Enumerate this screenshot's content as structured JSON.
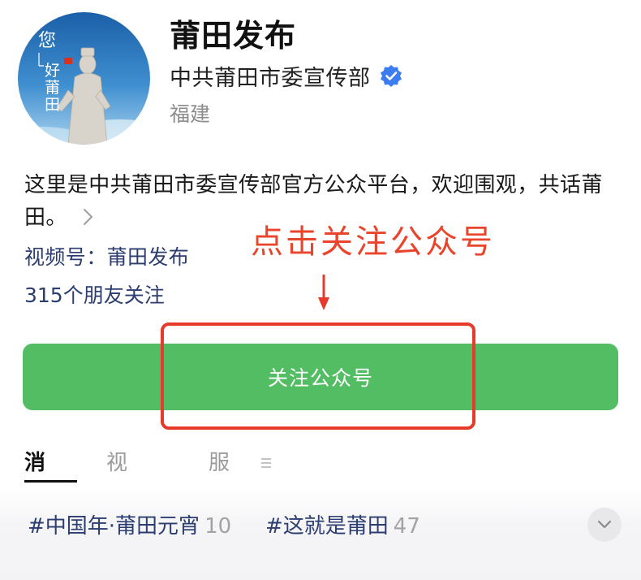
{
  "account": {
    "name": "莆田发布",
    "organization": "中共莆田市委宣传部",
    "region": "福建",
    "avatar_text": [
      "您",
      "好",
      "莆",
      "田"
    ]
  },
  "description": {
    "text": "这里是中共莆田市委宣传部官方公众平台，欢迎围观，共话莆田。"
  },
  "channel": {
    "label": "视频号：",
    "name": "莆田发布"
  },
  "followers": {
    "text": "315个朋友关注"
  },
  "annotation": {
    "text": "点击关注公众号",
    "color": "#e8452c"
  },
  "follow_button": {
    "label": "关注公众号",
    "color": "#52bd63"
  },
  "tabs": [
    {
      "label": "消息",
      "active": true
    },
    {
      "label": "视频号",
      "active": false
    },
    {
      "label": "服务",
      "active": false
    }
  ],
  "tags": [
    {
      "label": "#中国年·莆田元宵",
      "count": "10"
    },
    {
      "label": "#这就是莆田",
      "count": "47"
    }
  ],
  "colors": {
    "verified": "#3d7cf0",
    "link": "#2c3d70"
  }
}
